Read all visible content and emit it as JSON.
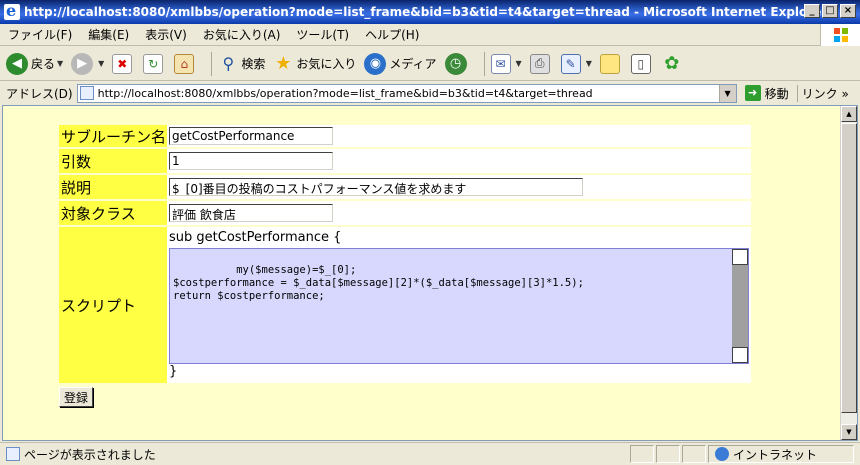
{
  "window": {
    "title": "http://localhost:8080/xmlbbs/operation?mode=list_frame&bid=b3&tid=t4&target=thread - Microsoft Internet Explorer",
    "min": "_",
    "max": "□",
    "close": "×"
  },
  "menu": {
    "items": [
      {
        "label": "ファイル(F)"
      },
      {
        "label": "編集(E)"
      },
      {
        "label": "表示(V)"
      },
      {
        "label": "お気に入り(A)"
      },
      {
        "label": "ツール(T)"
      },
      {
        "label": "ヘルプ(H)"
      }
    ]
  },
  "toolbar": {
    "back": "戻る",
    "search": "検索",
    "favorites": "お気に入り",
    "media": "メディア"
  },
  "address": {
    "label": "アドレス(D)",
    "url": "http://localhost:8080/xmlbbs/operation?mode=list_frame&bid=b3&tid=t4&target=thread",
    "go": "移動",
    "links": "リンク"
  },
  "form": {
    "subroutine_label": "サブルーチン名",
    "subroutine_value": "getCostPerformance",
    "args_label": "引数",
    "args_value": "1",
    "desc_label": "説明",
    "desc_value": "$_[0]番目の投稿のコストパフォーマンス値を求めます",
    "class_label": "対象クラス",
    "class_value": "評価 飲食店",
    "script_label": "スクリプト",
    "script_header": "sub getCostPerformance {",
    "script_body": "my($message)=$_[0];\n$costperformance = $_data[$message][2]*($_data[$message][3]*1.5);\nreturn $costperformance;",
    "script_footer": "}",
    "submit": "登録"
  },
  "status": {
    "text": "ページが表示されました",
    "zone": "イントラネット"
  },
  "colors": {
    "page_bg": "#ffffcc",
    "label_bg": "#ffff44",
    "textarea_bg": "#d8d8ff"
  }
}
